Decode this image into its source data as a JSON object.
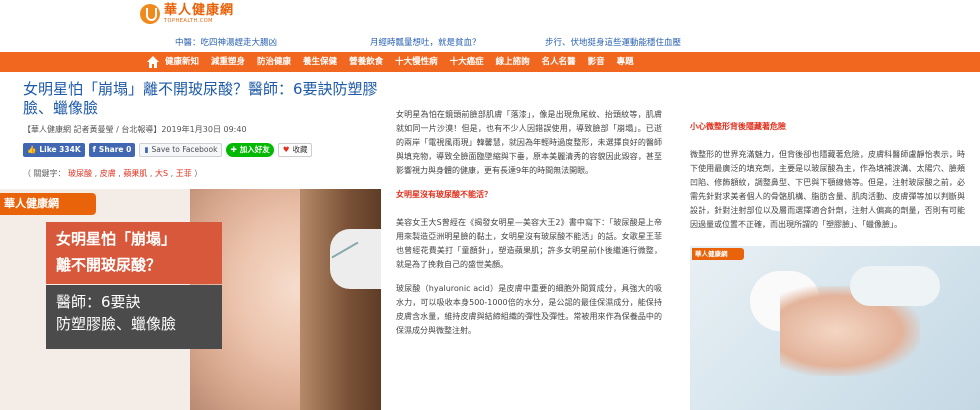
{
  "header": {
    "logo_name": "華人健康網",
    "logo_sub": "TOPHEALTH.COM",
    "ticker": [
      "中醫：吃四神湯趕走大腸凶",
      "月經時瓢量想吐，就是貧血？",
      "步行、伏地挺身這些運動能穩住血壓"
    ]
  },
  "nav": {
    "home_icon": "home-icon",
    "items": [
      "健康新知",
      "減重塑身",
      "防治健康",
      "養生保健",
      "營養飲食",
      "十大慢性病",
      "十大癌症",
      "線上諮詢",
      "名人名醫",
      "影音",
      "專題"
    ]
  },
  "article": {
    "title": "女明星怕「崩塌」離不開玻尿酸？醫師：6要訣防塑膠臉、蠟像臉",
    "byline": "【華人健康網 記者黃曼瑩 / 台北報導】2019年1月30日 09:40",
    "share": {
      "like": "Like 334K",
      "share": "Share 0",
      "save": "Save to Facebook",
      "line": "加入好友",
      "collect": "收藏"
    },
    "keywords_label": "（ 關鍵字：",
    "keywords": [
      "玻尿酸",
      "皮膚",
      "蘋果肌",
      "大S",
      "王菲"
    ],
    "keywords_end": "）"
  },
  "hero": {
    "brand": "華人健康網",
    "headline_1": "女明星怕「崩塌」",
    "headline_2": "離不開玻尿酸？",
    "sub_1": "醫師：6要訣",
    "sub_2": "防塑膠臉、蠟像臉"
  },
  "middle": {
    "p1": "女明星為怕在鏡頭前臉部肌膚「落漆」，像是出現魚尾紋、抬頭紋等，肌膚就如同一片沙漠！但是，也有不少人因錯誤使用，導致臉部「崩塌」。已逝的兩岸「電視風雨現」韓馨慧，就因為年輕時過度整形，未選擇良好的醫師與填充物，導致全臉面臨墜縮與下垂，原本美麗清秀的容貌因此毀容，甚至影響視力與身體的健康，更有長達9年的時間無法開眼。",
    "sub": "女明星沒有玻尿酸不能活？",
    "p2": "美容女王大S曾經在《揭發女明星—美容大王2》書中寫下：「玻尿酸是上帝用來製造亞洲明星臉的黏土，女明星沒有玻尿酸不能活」的話。女歌星王菲也曾經花費美打「童顏針」，塑造蘋果肌；許多女明星前仆後繼進行微整，就是為了挽救自己的盛世美顏。",
    "p3": "玻尿酸（hyaluronic acid）是皮膚中重要的細胞外間質成分，具強大的吸水力，可以吸收本身500-1000倍的水分，是公認的最佳保濕成分，能保持皮膚含水量，維持皮膚與結締組織的彈性及彈性。常被用來作為保養品中的保濕成分與微整注射。"
  },
  "right": {
    "sub": "小心微整形背後隱藏著危險",
    "p1": "微整形的世界充滿魅力，但背後卻也隱藏著危險，皮膚科醫師盧靜怡表示，時下使用最廣泛的填充劑，主要是以玻尿酸為主，作為填補淚溝、太陽穴、臉頰凹陷、修飾額紋，調整鼻型、下巴與下顎線條等。但是，注射玻尿酸之前，必需先針對求美者個人的骨骼肌構、脂肪含量、肌肉活動、皮膚彈等加以判斷與設計，針對注射部位以及層而選擇適合針劑，注射人偏高的劑量，否則有可能因過量或位置不正確，而出現所謂的「塑膠臉」、「蠟像臉」。",
    "img_brand": "華人健康網"
  }
}
